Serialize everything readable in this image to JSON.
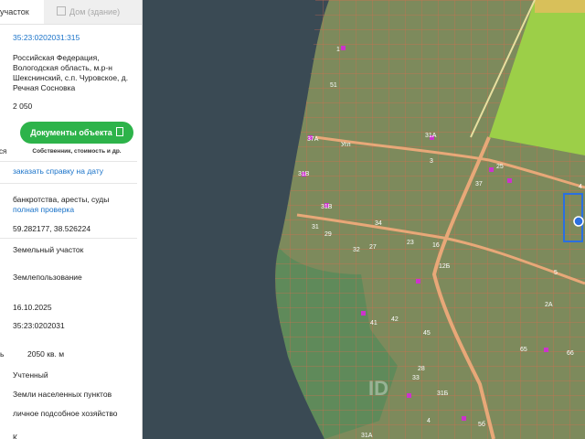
{
  "tabs": {
    "active": "участок",
    "inactive": "Дом (здание)"
  },
  "parcel": {
    "cadastral_number": "35:23:0202031:315",
    "address": "Российская Федерация, Вологодская область, м.р-н Шекснинский, с.п. Чуровское, д. Речная Сосновка",
    "area_value": "2 050"
  },
  "documents_button": {
    "label": "Документы объекта",
    "subtitle": "Собственник, стоимость и др.",
    "left_cut_text": "ся"
  },
  "links": {
    "order_certificate": "заказать справку на дату",
    "full_check": "полная проверка"
  },
  "risk_text": "банкротства, аресты, суды",
  "coordinates": "59.282177, 38.526224",
  "details": {
    "object_type": "Земельный участок",
    "right_type": "Землепользование",
    "date": "16.10.2025",
    "quarter": "35:23:0202031",
    "area_label_cut": "ь",
    "area": "2050 кв. м",
    "status": "Учтенный",
    "category": "Земли населенных пунктов",
    "permitted_use": "личное подсобное хозяйство",
    "last_cut": "К"
  },
  "map": {
    "street_label": "Угл",
    "watermark": "ID",
    "parcel_labels": [
      "1",
      "51",
      "37А",
      "31В",
      "31В",
      "31",
      "34",
      "27",
      "23",
      "29",
      "32",
      "31А",
      "3",
      "37",
      "25",
      "4",
      "12Б",
      "16",
      "5",
      "2А",
      "41",
      "42",
      "45",
      "65",
      "66",
      "33",
      "28",
      "31Б",
      "5б",
      "31А",
      "4"
    ]
  },
  "colors": {
    "accent_button": "#2db34a",
    "link": "#1a73c9",
    "water": "#3a4a54",
    "field": "#9ccf48",
    "parcel_outline": "#e2674a",
    "marker": "#cc33cc",
    "selected": "#2b6fe0"
  }
}
